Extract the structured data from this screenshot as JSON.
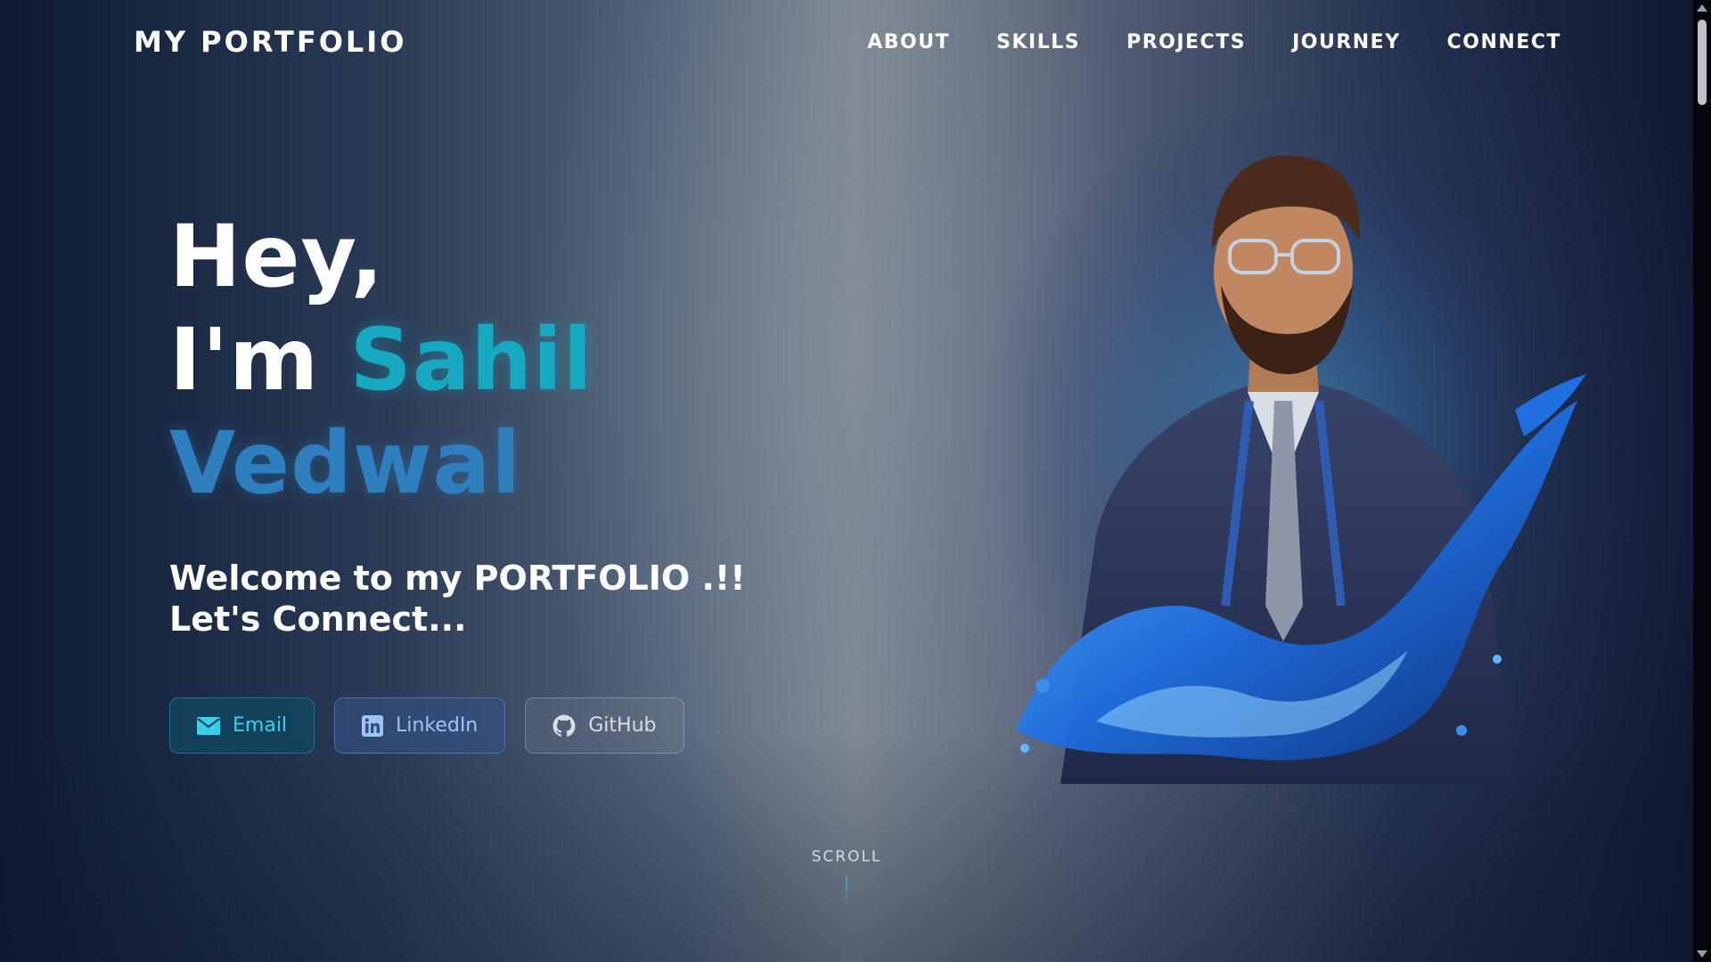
{
  "nav": {
    "logo": "MY PORTFOLIO",
    "links": [
      "ABOUT",
      "SKILLS",
      "PROJECTS",
      "JOURNEY",
      "CONNECT"
    ]
  },
  "hero": {
    "line1": "Hey,",
    "line2_prefix": "I'm",
    "first_name": "Sahil",
    "last_name": "Vedwal",
    "welcome_line1": "Welcome to my PORTFOLIO .!!",
    "welcome_line2": "Let's Connect..."
  },
  "buttons": {
    "email": {
      "label": "Email",
      "icon": "mail-icon"
    },
    "linkedin": {
      "label": "LinkedIn",
      "icon": "linkedin-icon"
    },
    "github": {
      "label": "GitHub",
      "icon": "github-icon"
    }
  },
  "scroll_hint": "SCROLL",
  "colors": {
    "accent_cyan": "#17a9c1",
    "accent_blue": "#2f7fbf",
    "background_dark": "#0e1a34"
  }
}
